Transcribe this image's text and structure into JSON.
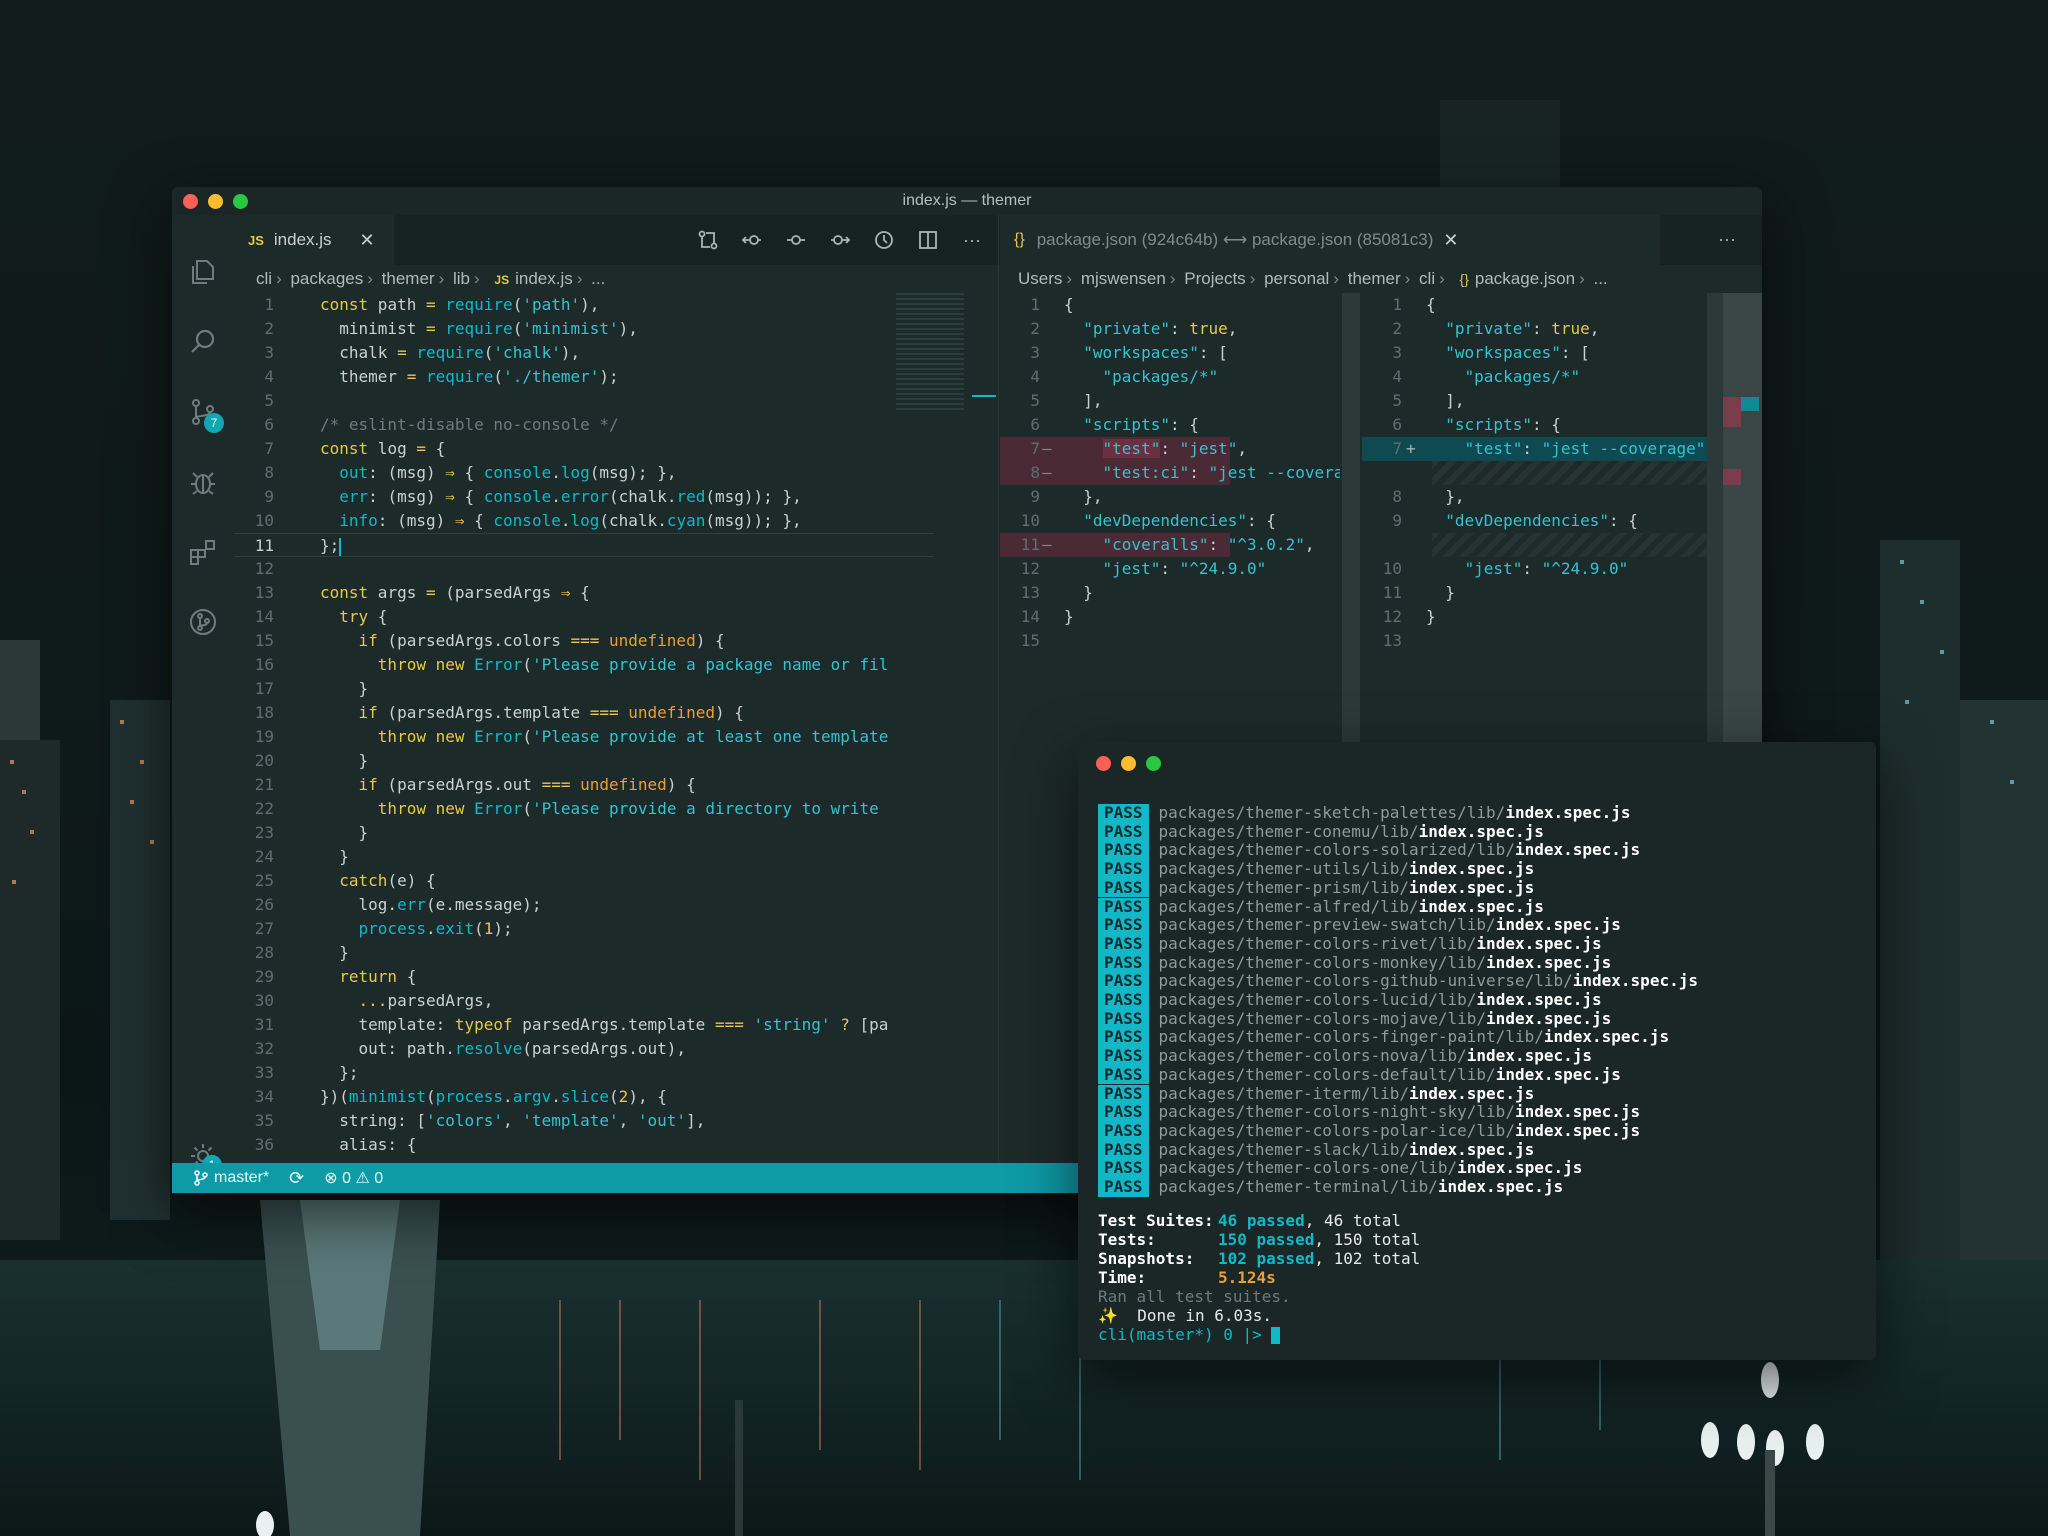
{
  "window": {
    "title": "index.js — themer"
  },
  "activity_bar": {
    "scm_badge": "7",
    "settings_badge": "1"
  },
  "left_editor": {
    "tab": {
      "icon": "JS",
      "label": "index.js",
      "close": "✕"
    },
    "breadcrumb": [
      "cli",
      "packages",
      "themer",
      "lib",
      "index.js",
      "..."
    ],
    "breadcrumb_icon": "JS"
  },
  "right_editor": {
    "tab": {
      "icon": "{}",
      "label": "package.json (924c64b) ⟷ package.json (85081c3)",
      "close": "✕"
    },
    "more": "···",
    "breadcrumb": [
      "Users",
      "mjswensen",
      "Projects",
      "personal",
      "themer",
      "cli",
      "package.json",
      "..."
    ],
    "breadcrumb_icon": "{}"
  },
  "editor_toolbar": {
    "more": "···"
  },
  "status_bar": {
    "branch": "master*",
    "errors": "0",
    "warnings": "0"
  },
  "code_lines": [
    "1",
    "2",
    "3",
    "4",
    "5",
    "6",
    "7",
    "8",
    "9",
    "10",
    "11",
    "12",
    "13",
    "14",
    "15",
    "16",
    "17",
    "18",
    "19",
    "20",
    "21",
    "22",
    "23",
    "24",
    "25",
    "26",
    "27",
    "28",
    "29",
    "30",
    "31",
    "32",
    "33",
    "34",
    "35",
    "36"
  ],
  "diff_left_lines": [
    "1",
    "2",
    "3",
    "4",
    "5",
    "6",
    "7",
    "8",
    "9",
    "10",
    "11",
    "12",
    "13",
    "14",
    "15"
  ],
  "diff_right_lines": [
    "1",
    "2",
    "3",
    "4",
    "5",
    "6",
    "7",
    "8",
    "9",
    "10",
    "11",
    "12",
    "13"
  ],
  "terminal": {
    "pass_label": "PASS",
    "results": [
      {
        "dir": "packages/themer-sketch-palettes/lib/",
        "file": "index.spec.js"
      },
      {
        "dir": "packages/themer-conemu/lib/",
        "file": "index.spec.js"
      },
      {
        "dir": "packages/themer-colors-solarized/lib/",
        "file": "index.spec.js"
      },
      {
        "dir": "packages/themer-utils/lib/",
        "file": "index.spec.js"
      },
      {
        "dir": "packages/themer-prism/lib/",
        "file": "index.spec.js"
      },
      {
        "dir": "packages/themer-alfred/lib/",
        "file": "index.spec.js"
      },
      {
        "dir": "packages/themer-preview-swatch/lib/",
        "file": "index.spec.js"
      },
      {
        "dir": "packages/themer-colors-rivet/lib/",
        "file": "index.spec.js"
      },
      {
        "dir": "packages/themer-colors-monkey/lib/",
        "file": "index.spec.js"
      },
      {
        "dir": "packages/themer-colors-github-universe/lib/",
        "file": "index.spec.js"
      },
      {
        "dir": "packages/themer-colors-lucid/lib/",
        "file": "index.spec.js"
      },
      {
        "dir": "packages/themer-colors-mojave/lib/",
        "file": "index.spec.js"
      },
      {
        "dir": "packages/themer-colors-finger-paint/lib/",
        "file": "index.spec.js"
      },
      {
        "dir": "packages/themer-colors-nova/lib/",
        "file": "index.spec.js"
      },
      {
        "dir": "packages/themer-colors-default/lib/",
        "file": "index.spec.js"
      },
      {
        "dir": "packages/themer-iterm/lib/",
        "file": "index.spec.js"
      },
      {
        "dir": "packages/themer-colors-night-sky/lib/",
        "file": "index.spec.js"
      },
      {
        "dir": "packages/themer-colors-polar-ice/lib/",
        "file": "index.spec.js"
      },
      {
        "dir": "packages/themer-slack/lib/",
        "file": "index.spec.js"
      },
      {
        "dir": "packages/themer-colors-one/lib/",
        "file": "index.spec.js"
      },
      {
        "dir": "packages/themer-terminal/lib/",
        "file": "index.spec.js"
      }
    ],
    "summary": {
      "suites_label": "Test Suites:",
      "suites_passed": "46 passed",
      "suites_total": ", 46 total",
      "tests_label": "Tests:",
      "tests_passed": "150 passed",
      "tests_total": ", 150 total",
      "snapshots_label": "Snapshots:",
      "snapshots_passed": "102 passed",
      "snapshots_total": ", 102 total",
      "time_label": "Time:",
      "time_value": "5.124s",
      "ran": "Ran all test suites.",
      "done": "✨  Done in 6.03s.",
      "prompt": "cli(master*) 0 |>"
    }
  },
  "colors": {
    "accent": "#12b8c6",
    "keyword": "#e6c84a",
    "statusbar": "#0e9aa6"
  }
}
